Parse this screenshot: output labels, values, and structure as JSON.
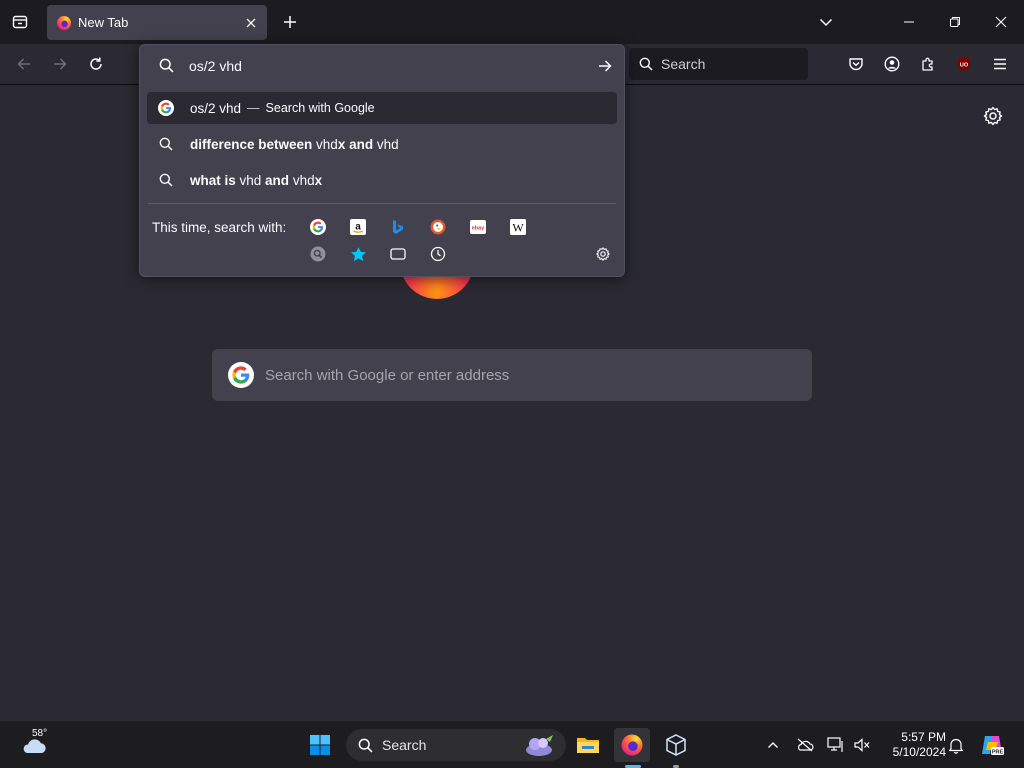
{
  "browser": {
    "tab": {
      "title": "New Tab"
    },
    "searchbar": {
      "placeholder": "Search"
    },
    "urlbar": {
      "value": "os/2 vhd",
      "results": [
        {
          "kind": "search-engine",
          "text": "os/2 vhd",
          "separator": "—",
          "action": "Search with Google",
          "selected": true
        },
        {
          "kind": "suggestion",
          "parts": [
            {
              "t": "difference between ",
              "b": true
            },
            {
              "t": "vhd",
              "b": false
            },
            {
              "t": "x and ",
              "b": true
            },
            {
              "t": "vhd",
              "b": false
            }
          ]
        },
        {
          "kind": "suggestion",
          "parts": [
            {
              "t": "what is ",
              "b": true
            },
            {
              "t": "vhd ",
              "b": false
            },
            {
              "t": "and ",
              "b": true
            },
            {
              "t": "vhd",
              "b": false
            },
            {
              "t": "x",
              "b": true
            }
          ]
        }
      ],
      "one_off_label": "This time, search with:",
      "engines": [
        "Google",
        "Amazon",
        "Bing",
        "DuckDuckGo",
        "eBay",
        "Wikipedia",
        "Search",
        "Bookmarks",
        "Tabs",
        "History"
      ],
      "ebay_glyph": "ebay",
      "wiki_glyph": "W"
    },
    "ntp": {
      "search_placeholder": "Search with Google or enter address"
    },
    "extension_badge": "UO"
  },
  "taskbar": {
    "weather_temp": "58°",
    "search_placeholder": "Search",
    "time": "5:57 PM",
    "date": "5/10/2024",
    "copilot_badge": "PRE"
  },
  "colors": {
    "toolbar": "#2b2a33",
    "tabstrip": "#1c1b22",
    "panel": "#42414d",
    "accent_blue": "#5fb2f2"
  }
}
